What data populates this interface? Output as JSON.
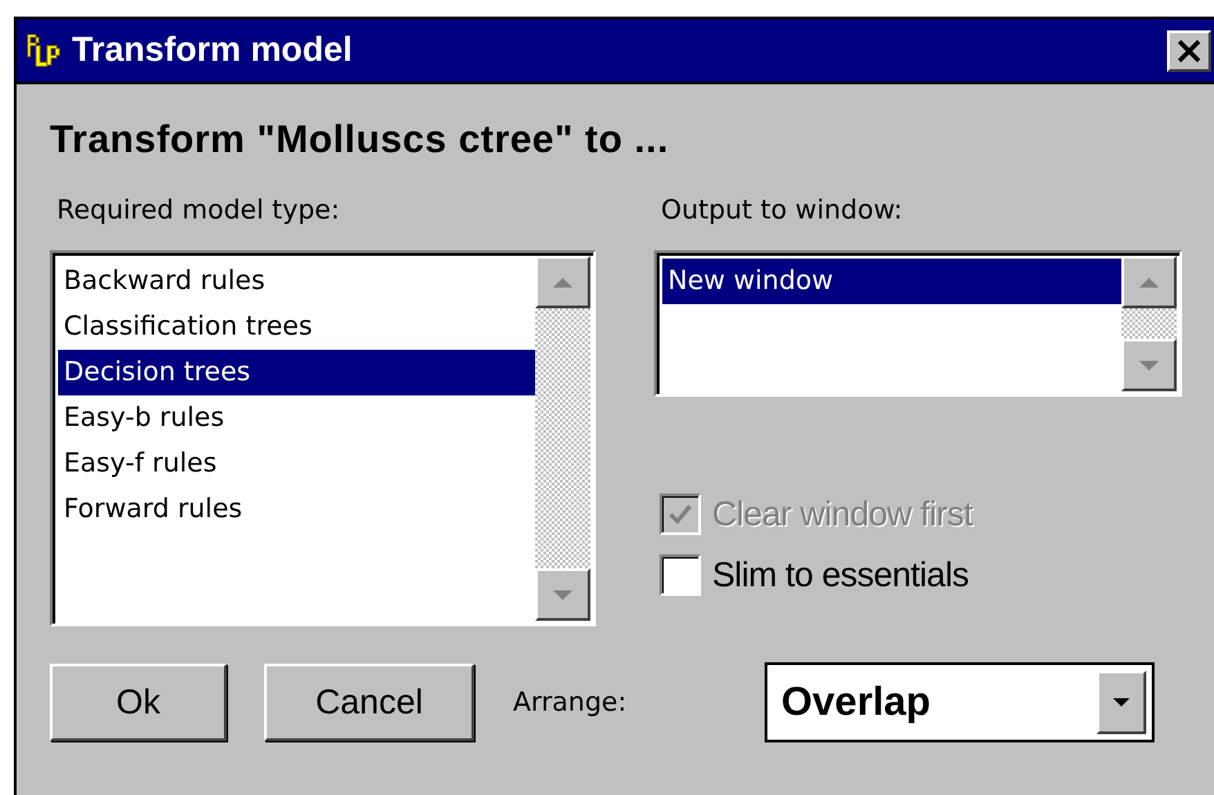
{
  "window": {
    "title": "Transform model"
  },
  "heading": "Transform \"Molluscs ctree\" to ...",
  "model_type": {
    "label": "Required model type:",
    "items": [
      {
        "label": "Backward rules",
        "selected": false
      },
      {
        "label": "Classification trees",
        "selected": false
      },
      {
        "label": "Decision trees",
        "selected": true
      },
      {
        "label": "Easy-b rules",
        "selected": false
      },
      {
        "label": "Easy-f rules",
        "selected": false
      },
      {
        "label": "Forward rules",
        "selected": false
      }
    ]
  },
  "output": {
    "label": "Output to window:",
    "items": [
      {
        "label": "New window",
        "selected": true
      }
    ]
  },
  "options": [
    {
      "label": "Clear window first",
      "checked": true,
      "disabled": true
    },
    {
      "label": "Slim to essentials",
      "checked": false,
      "disabled": false
    }
  ],
  "buttons": [
    "Ok",
    "Cancel"
  ],
  "arrange": {
    "label": "Arrange:",
    "value": "Overlap"
  }
}
